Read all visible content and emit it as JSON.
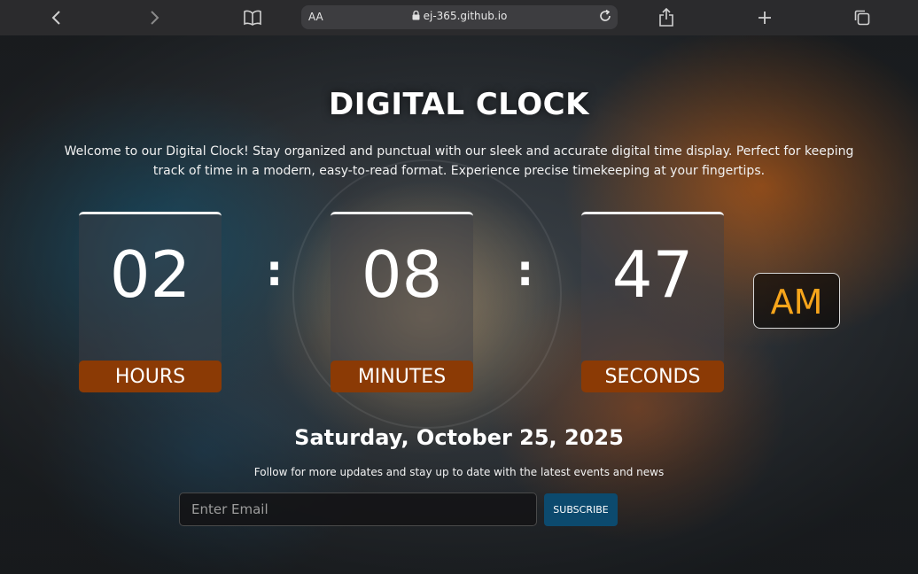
{
  "browser": {
    "text_size_label": "AA",
    "url": "ej-365.github.io"
  },
  "page": {
    "title": "DIGITAL CLOCK",
    "description": "Welcome to our Digital Clock! Stay organized and punctual with our sleek and accurate digital time display. Perfect for keeping track of time in a modern, easy-to-read format. Experience precise timekeeping at your fingertips."
  },
  "clock": {
    "hours": "02",
    "minutes": "08",
    "seconds": "47",
    "hours_label": "HOURS",
    "minutes_label": "MINUTES",
    "seconds_label": "SECONDS",
    "separator": ":",
    "period": "AM"
  },
  "date": "Saturday, October 25, 2025",
  "newsletter": {
    "text": "Follow for more updates and stay up to date with the latest events and news",
    "email_placeholder": "Enter Email",
    "button_label": "SUBSCRIBE"
  },
  "colors": {
    "label_bg": "#8b3a05",
    "period_text": "#f7a51b",
    "button_bg": "#0c4a6e",
    "toolbar_bg": "#2b2b2d"
  }
}
